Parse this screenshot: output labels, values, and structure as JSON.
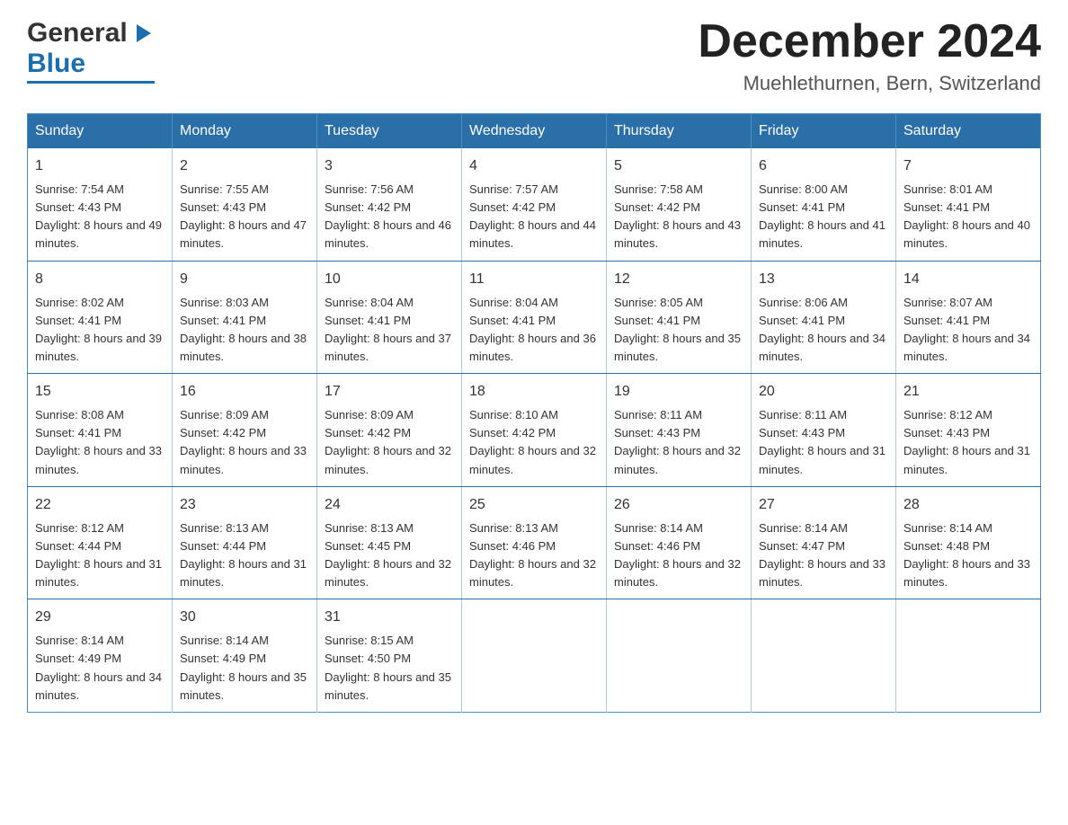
{
  "header": {
    "logo_general": "General",
    "logo_blue": "Blue",
    "month_year": "December 2024",
    "location": "Muehlethurnen, Bern, Switzerland"
  },
  "weekdays": [
    "Sunday",
    "Monday",
    "Tuesday",
    "Wednesday",
    "Thursday",
    "Friday",
    "Saturday"
  ],
  "weeks": [
    [
      {
        "day": "1",
        "sunrise": "7:54 AM",
        "sunset": "4:43 PM",
        "daylight": "8 hours and 49 minutes."
      },
      {
        "day": "2",
        "sunrise": "7:55 AM",
        "sunset": "4:43 PM",
        "daylight": "8 hours and 47 minutes."
      },
      {
        "day": "3",
        "sunrise": "7:56 AM",
        "sunset": "4:42 PM",
        "daylight": "8 hours and 46 minutes."
      },
      {
        "day": "4",
        "sunrise": "7:57 AM",
        "sunset": "4:42 PM",
        "daylight": "8 hours and 44 minutes."
      },
      {
        "day": "5",
        "sunrise": "7:58 AM",
        "sunset": "4:42 PM",
        "daylight": "8 hours and 43 minutes."
      },
      {
        "day": "6",
        "sunrise": "8:00 AM",
        "sunset": "4:41 PM",
        "daylight": "8 hours and 41 minutes."
      },
      {
        "day": "7",
        "sunrise": "8:01 AM",
        "sunset": "4:41 PM",
        "daylight": "8 hours and 40 minutes."
      }
    ],
    [
      {
        "day": "8",
        "sunrise": "8:02 AM",
        "sunset": "4:41 PM",
        "daylight": "8 hours and 39 minutes."
      },
      {
        "day": "9",
        "sunrise": "8:03 AM",
        "sunset": "4:41 PM",
        "daylight": "8 hours and 38 minutes."
      },
      {
        "day": "10",
        "sunrise": "8:04 AM",
        "sunset": "4:41 PM",
        "daylight": "8 hours and 37 minutes."
      },
      {
        "day": "11",
        "sunrise": "8:04 AM",
        "sunset": "4:41 PM",
        "daylight": "8 hours and 36 minutes."
      },
      {
        "day": "12",
        "sunrise": "8:05 AM",
        "sunset": "4:41 PM",
        "daylight": "8 hours and 35 minutes."
      },
      {
        "day": "13",
        "sunrise": "8:06 AM",
        "sunset": "4:41 PM",
        "daylight": "8 hours and 34 minutes."
      },
      {
        "day": "14",
        "sunrise": "8:07 AM",
        "sunset": "4:41 PM",
        "daylight": "8 hours and 34 minutes."
      }
    ],
    [
      {
        "day": "15",
        "sunrise": "8:08 AM",
        "sunset": "4:41 PM",
        "daylight": "8 hours and 33 minutes."
      },
      {
        "day": "16",
        "sunrise": "8:09 AM",
        "sunset": "4:42 PM",
        "daylight": "8 hours and 33 minutes."
      },
      {
        "day": "17",
        "sunrise": "8:09 AM",
        "sunset": "4:42 PM",
        "daylight": "8 hours and 32 minutes."
      },
      {
        "day": "18",
        "sunrise": "8:10 AM",
        "sunset": "4:42 PM",
        "daylight": "8 hours and 32 minutes."
      },
      {
        "day": "19",
        "sunrise": "8:11 AM",
        "sunset": "4:43 PM",
        "daylight": "8 hours and 32 minutes."
      },
      {
        "day": "20",
        "sunrise": "8:11 AM",
        "sunset": "4:43 PM",
        "daylight": "8 hours and 31 minutes."
      },
      {
        "day": "21",
        "sunrise": "8:12 AM",
        "sunset": "4:43 PM",
        "daylight": "8 hours and 31 minutes."
      }
    ],
    [
      {
        "day": "22",
        "sunrise": "8:12 AM",
        "sunset": "4:44 PM",
        "daylight": "8 hours and 31 minutes."
      },
      {
        "day": "23",
        "sunrise": "8:13 AM",
        "sunset": "4:44 PM",
        "daylight": "8 hours and 31 minutes."
      },
      {
        "day": "24",
        "sunrise": "8:13 AM",
        "sunset": "4:45 PM",
        "daylight": "8 hours and 32 minutes."
      },
      {
        "day": "25",
        "sunrise": "8:13 AM",
        "sunset": "4:46 PM",
        "daylight": "8 hours and 32 minutes."
      },
      {
        "day": "26",
        "sunrise": "8:14 AM",
        "sunset": "4:46 PM",
        "daylight": "8 hours and 32 minutes."
      },
      {
        "day": "27",
        "sunrise": "8:14 AM",
        "sunset": "4:47 PM",
        "daylight": "8 hours and 33 minutes."
      },
      {
        "day": "28",
        "sunrise": "8:14 AM",
        "sunset": "4:48 PM",
        "daylight": "8 hours and 33 minutes."
      }
    ],
    [
      {
        "day": "29",
        "sunrise": "8:14 AM",
        "sunset": "4:49 PM",
        "daylight": "8 hours and 34 minutes."
      },
      {
        "day": "30",
        "sunrise": "8:14 AM",
        "sunset": "4:49 PM",
        "daylight": "8 hours and 35 minutes."
      },
      {
        "day": "31",
        "sunrise": "8:15 AM",
        "sunset": "4:50 PM",
        "daylight": "8 hours and 35 minutes."
      },
      null,
      null,
      null,
      null
    ]
  ]
}
